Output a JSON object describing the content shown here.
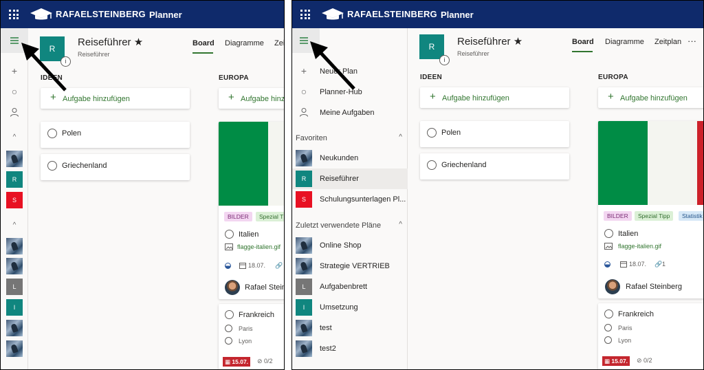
{
  "header": {
    "brand": "RAFAELSTEINBERG",
    "app": "Planner"
  },
  "nav": {
    "new_plan": "Neuer Plan",
    "hub": "Planner-Hub",
    "my_tasks": "Meine Aufgaben",
    "favorites_label": "Favoriten",
    "favorites": [
      {
        "label": "Neukunden",
        "kind": "image"
      },
      {
        "label": "Reiseführer",
        "kind": "tile",
        "letter": "R",
        "color": "#10867f"
      },
      {
        "label": "Schulungsunterlagen Pl...",
        "kind": "tile",
        "letter": "S",
        "color": "#e81123"
      }
    ],
    "recent_label": "Zuletzt verwendete Pläne",
    "recent": [
      {
        "label": "Online Shop",
        "kind": "image"
      },
      {
        "label": "Strategie VERTRIEB",
        "kind": "image"
      },
      {
        "label": "Aufgabenbrett",
        "kind": "tile",
        "letter": "L",
        "color": "#767676"
      },
      {
        "label": "Umsetzung",
        "kind": "tile",
        "letter": "I",
        "color": "#10867f"
      },
      {
        "label": "test",
        "kind": "image"
      },
      {
        "label": "test2",
        "kind": "image"
      }
    ]
  },
  "plan": {
    "letter": "R",
    "title": "Reiseführer",
    "star": "★",
    "subtitle": "Reiseführer",
    "info": "i",
    "tabs": [
      "Board",
      "Diagramme",
      "Zeitplan"
    ],
    "tabs_left": [
      "Board",
      "Diagramme",
      "Zeit"
    ],
    "more": "···"
  },
  "board": {
    "add_task": "Aufgabe hinzufügen",
    "add_task_truncated": "Aufgabe hinzu",
    "columns": [
      {
        "name": "IDEEN",
        "tasks": [
          "Polen",
          "Griechenland"
        ]
      },
      {
        "name": "EUROPA"
      }
    ],
    "italy_card": {
      "labels": [
        {
          "text": "BILDER",
          "bg": "#f3d6f1",
          "fg": "#7a2a74"
        },
        {
          "text": "Spezial Tipp",
          "bg": "#dbf0d6",
          "fg": "#2f6b2b"
        },
        {
          "text": "Statistik",
          "bg": "#d6e8f7",
          "fg": "#24548a"
        }
      ],
      "labels_left": [
        "BILDER",
        "Spezial T"
      ],
      "title": "Italien",
      "attachment": "flagge-italien.gif",
      "attachment_left": "flagge-italien.gif",
      "date": "18.07.",
      "attach_count": "1",
      "assignee": "Rafael Steinberg",
      "assignee_left": "Rafael Steinb",
      "flag_colors": [
        "#008c45",
        "#f4f5f0",
        "#cd212a"
      ]
    },
    "france_card": {
      "title": "Frankreich",
      "items": [
        "Paris",
        "Lyon"
      ],
      "due": "15.07.",
      "checklist": "0/2"
    }
  }
}
